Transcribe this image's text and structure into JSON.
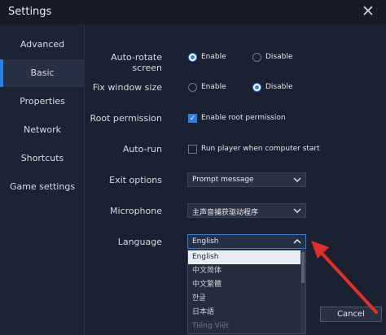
{
  "window": {
    "title": "Settings"
  },
  "sidebar": {
    "items": [
      {
        "label": "Advanced"
      },
      {
        "label": "Basic"
      },
      {
        "label": "Properties"
      },
      {
        "label": "Network"
      },
      {
        "label": "Shortcuts"
      },
      {
        "label": "Game settings"
      }
    ],
    "active": "Basic"
  },
  "settings": {
    "auto_rotate": {
      "label": "Auto-rotate screen",
      "option_enable": "Enable",
      "option_disable": "Disable",
      "selected": "Enable"
    },
    "fix_window_size": {
      "label": "Fix window size",
      "option_enable": "Enable",
      "option_disable": "Disable",
      "selected": "Disable"
    },
    "root_permission": {
      "label": "Root permission",
      "checkbox_label": "Enable root permission",
      "checked": true
    },
    "auto_run": {
      "label": "Auto-run",
      "checkbox_label": "Run player when computer start",
      "checked": false
    },
    "exit_options": {
      "label": "Exit options",
      "value": "Prompt message"
    },
    "microphone": {
      "label": "Microphone",
      "value": "主声音捕获驱动程序"
    },
    "language": {
      "label": "Language",
      "value": "English",
      "options": [
        "English",
        "中文简体",
        "中文繁體",
        "한글",
        "日本語",
        "Tiếng Việt"
      ]
    }
  },
  "footer": {
    "cancel_label": "Cancel"
  },
  "colors": {
    "accent": "#2f7ee8",
    "background": "#1b2130",
    "sidebar": "#1d2333",
    "arrow": "#e0302b"
  }
}
